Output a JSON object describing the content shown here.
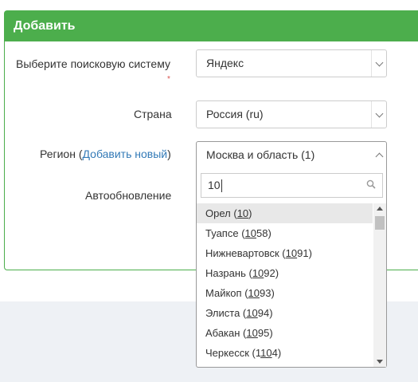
{
  "panel": {
    "title": "Добавить"
  },
  "form": {
    "engine_label": "Выберите поисковую систему",
    "required_mark": "*",
    "engine_value": "Яндекс",
    "country_label": "Страна",
    "country_value": "Россия (ru)",
    "region_label_prefix": "Регион (",
    "region_add_link": "Добавить новый",
    "region_label_suffix": ")",
    "region_value": "Москва и область (1)",
    "auto_label": "Автообновление"
  },
  "dropdown": {
    "search_value": "10",
    "options": [
      {
        "name": "Орел",
        "pre": "",
        "match": "10",
        "post": "",
        "highlighted": true
      },
      {
        "name": "Туапсе",
        "pre": "",
        "match": "10",
        "post": "58",
        "highlighted": false
      },
      {
        "name": "Нижневартовск",
        "pre": "",
        "match": "10",
        "post": "91",
        "highlighted": false
      },
      {
        "name": "Назрань",
        "pre": "",
        "match": "10",
        "post": "92",
        "highlighted": false
      },
      {
        "name": "Майкоп",
        "pre": "",
        "match": "10",
        "post": "93",
        "highlighted": false
      },
      {
        "name": "Элиста",
        "pre": "",
        "match": "10",
        "post": "94",
        "highlighted": false
      },
      {
        "name": "Абакан",
        "pre": "",
        "match": "10",
        "post": "95",
        "highlighted": false
      },
      {
        "name": "Черкесск",
        "pre": "1",
        "match": "10",
        "post": "4",
        "highlighted": false
      }
    ]
  },
  "colors": {
    "header": "#4cae4c",
    "link": "#337ab7",
    "required": "#d9534f",
    "highlight": "#e8e8e8"
  }
}
